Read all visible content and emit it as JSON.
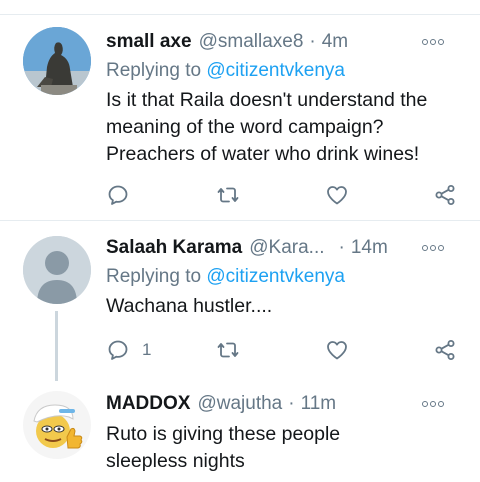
{
  "tweets": [
    {
      "name": "small axe",
      "handle": "@smallaxe8",
      "separator": "·",
      "time": "4m",
      "replying_prefix": "Replying to",
      "replying_to": "@citizentvkenya",
      "text": "Is it that Raila doesn't understand the\nmeaning of the word campaign?\nPreachers of water who drink wines!",
      "reply_count": ""
    },
    {
      "name": "Salaah Karama",
      "handle": "@Kara...",
      "separator": "·",
      "time": "14m",
      "replying_prefix": "Replying to",
      "replying_to": "@citizentvkenya",
      "text": "Wachana hustler....",
      "reply_count": "1"
    },
    {
      "name": "MADDOX",
      "handle": "@wajutha",
      "separator": "·",
      "time": "11m",
      "text": "Ruto is  giving  these people\nsleepless  nights"
    }
  ],
  "icons": {
    "reply": "reply-icon",
    "retweet": "retweet-icon",
    "like": "heart-icon",
    "share": "share-icon",
    "more": "more-options-icon"
  },
  "colors": {
    "mention": "#1da1f2",
    "secondary": "#657786",
    "divider": "#e6ecf0"
  }
}
